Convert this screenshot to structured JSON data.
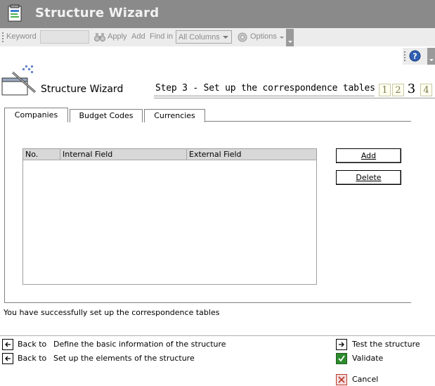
{
  "window": {
    "title": "Structure Wizard"
  },
  "toolbar": {
    "keyword_label": "Keyword",
    "keyword_value": "",
    "apply_label": "Apply",
    "add_label": "Add",
    "find_in_label": "Find in",
    "find_in_selected": "All Columns",
    "options_label": "Options"
  },
  "wizard": {
    "title": "Structure Wizard",
    "step_title": "Step 3 - Set up the correspondence tables",
    "steps": [
      "1",
      "2",
      "3",
      "4"
    ],
    "current_step": "3"
  },
  "tabs": [
    {
      "label": "Companies",
      "active": true
    },
    {
      "label": "Budget Codes",
      "active": false
    },
    {
      "label": "Currencies",
      "active": false
    }
  ],
  "grid": {
    "columns": [
      "No.",
      "Internal Field",
      "External Field"
    ],
    "rows": []
  },
  "buttons": {
    "add": "Add",
    "delete": "Delete"
  },
  "status_message": "You have successfully set up the correspondence tables",
  "nav": {
    "back1_prefix": "Back to",
    "back1_text": "Define the basic information of the structure",
    "back2_prefix": "Back to",
    "back2_text": "Set up the elements of the structure",
    "test": "Test the structure",
    "validate": "Validate",
    "cancel": "Cancel"
  },
  "colors": {
    "titlebar": "#8a8a8a",
    "toolbar": "#ececec",
    "validate_green": "#2e8b2e",
    "cancel_red": "#c0392b"
  }
}
